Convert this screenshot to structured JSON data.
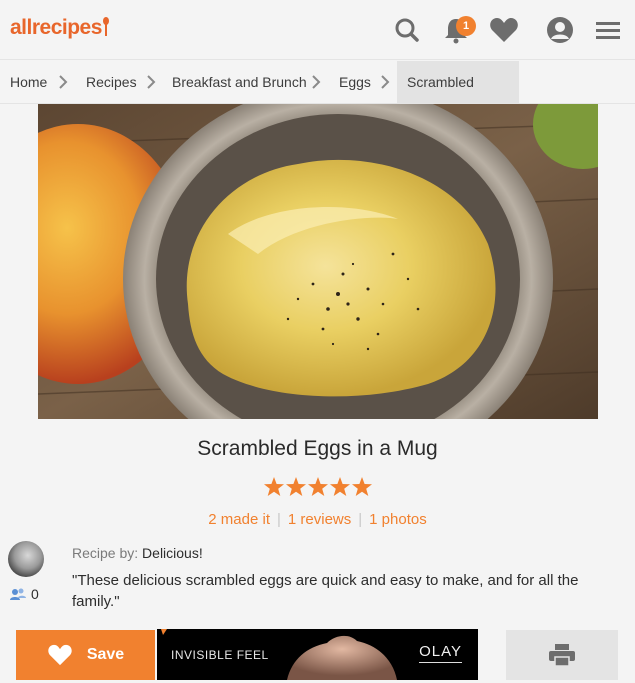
{
  "header": {
    "logo_text": "allrecipes",
    "notification_count": "1",
    "icons": [
      "search-icon",
      "bell-icon",
      "heart-icon",
      "profile-icon",
      "menu-icon"
    ]
  },
  "breadcrumb": [
    "Home",
    "Recipes",
    "Breakfast and Brunch",
    "Eggs",
    "Scrambled Eggs"
  ],
  "recipe": {
    "title": "Scrambled Eggs in a Mug",
    "rating": 5,
    "made_it": "2 made it",
    "reviews": "1 reviews",
    "photos": "1 photos",
    "recipe_by_label": "Recipe by:",
    "author": "Delicious!",
    "followers": "0",
    "description": "\"These delicious scrambled eggs are quick and easy to make, and for all the family.\""
  },
  "actions": {
    "save_label": "Save"
  },
  "ad": {
    "text": "INVISIBLE FEEL",
    "brand": "OLAY"
  },
  "colors": {
    "accent": "#f1812f",
    "brand": "#e8662b"
  }
}
